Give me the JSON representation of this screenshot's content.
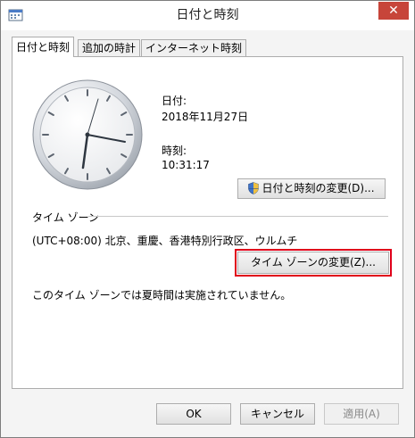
{
  "window": {
    "title": "日付と時刻",
    "close_label": "✕"
  },
  "tabs": [
    {
      "label": "日付と時刻",
      "active": true
    },
    {
      "label": "追加の時計",
      "active": false
    },
    {
      "label": "インターネット時刻",
      "active": false
    }
  ],
  "datetime": {
    "date_label": "日付:",
    "date_value": "2018年11月27日",
    "time_label": "時刻:",
    "time_value": "10:31:17",
    "change_button": "日付と時刻の変更(D)..."
  },
  "timezone": {
    "section_label": "タイム ゾーン",
    "value": "(UTC+08:00) 北京、重慶、香港特別行政区、ウルムチ",
    "change_button": "タイム ゾーンの変更(Z)...",
    "dst_note": "このタイム ゾーンでは夏時間は実施されていません。"
  },
  "footer": {
    "ok": "OK",
    "cancel": "キャンセル",
    "apply": "適用(A)"
  }
}
